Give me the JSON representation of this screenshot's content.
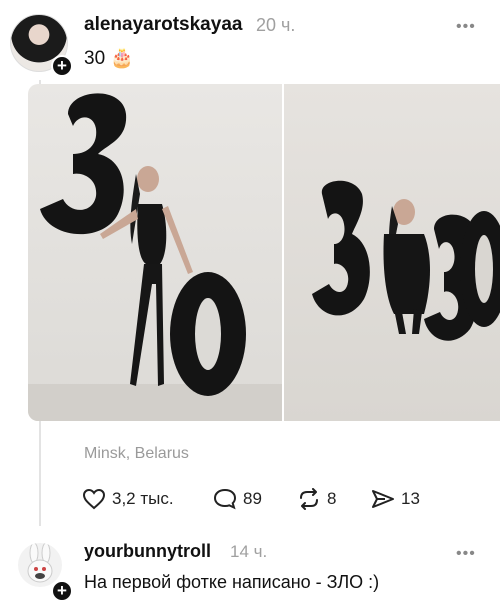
{
  "post": {
    "username": "alenayarotskayaa",
    "time": "20 ч.",
    "text": "30 🎂",
    "location": "Minsk, Belarus",
    "more_glyph": "•••",
    "photos": [
      {
        "alt_icon": "photo-balloons-30-standing"
      },
      {
        "alt_icon": "photo-balloons-30-crouching"
      }
    ],
    "actions": {
      "likes": "3,2 тыс.",
      "comments": "89",
      "reposts": "8",
      "shares": "13"
    }
  },
  "reply": {
    "username": "yourbunnytroll",
    "time": "14 ч.",
    "text": "На первой фотке написано - ЗЛО :)",
    "more_glyph": "•••"
  },
  "icons": {
    "like": "heart-icon",
    "comment": "comment-bubble-icon",
    "repost": "repost-arrows-icon",
    "share": "send-arrow-icon",
    "plus": "+"
  },
  "colors": {
    "text": "#111111",
    "muted": "#9a9a9a",
    "thread_line": "#e3e3e3",
    "balloon": "#141414"
  }
}
